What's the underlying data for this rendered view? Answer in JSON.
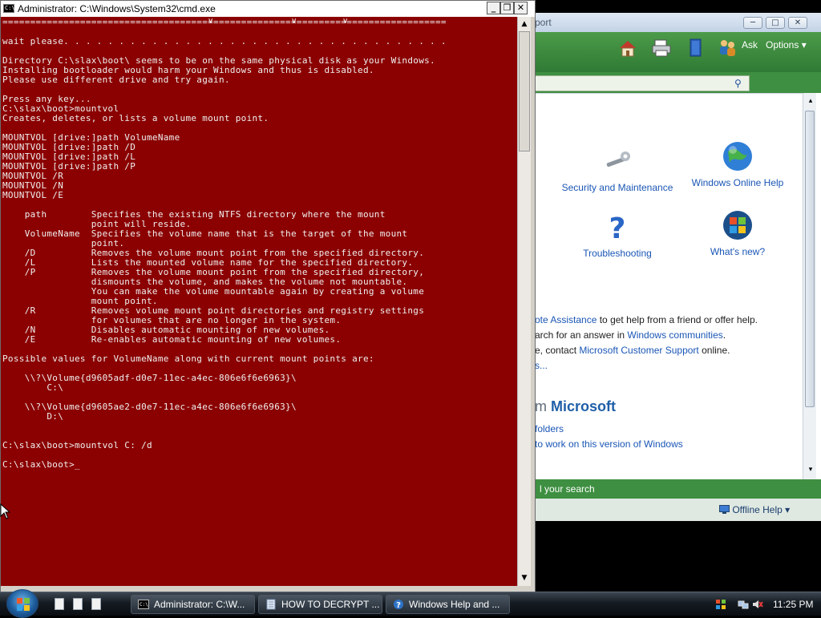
{
  "cmd": {
    "title": "Administrator: C:\\Windows\\System32\\cmd.exe",
    "icon_label": "C:\\",
    "lines": [
      "================================================================================",
      "",
      "wait please. . . . . . . . . . . . . . . . . . . . . . . . . . . . . . . . . . .",
      "",
      "Directory C:\\slax\\boot\\ seems to be on the same physical disk as your Windows.",
      "Installing bootloader would harm your Windows and thus is disabled.",
      "Please use different drive and try again.",
      "",
      "Press any key...",
      "C:\\slax\\boot>mountvol",
      "Creates, deletes, or lists a volume mount point.",
      "",
      "MOUNTVOL [drive:]path VolumeName",
      "MOUNTVOL [drive:]path /D",
      "MOUNTVOL [drive:]path /L",
      "MOUNTVOL [drive:]path /P",
      "MOUNTVOL /R",
      "MOUNTVOL /N",
      "MOUNTVOL /E",
      "",
      "    path        Specifies the existing NTFS directory where the mount",
      "                point will reside.",
      "    VolumeName  Specifies the volume name that is the target of the mount",
      "                point.",
      "    /D          Removes the volume mount point from the specified directory.",
      "    /L          Lists the mounted volume name for the specified directory.",
      "    /P          Removes the volume mount point from the specified directory,",
      "                dismounts the volume, and makes the volume not mountable.",
      "                You can make the volume mountable again by creating a volume",
      "                mount point.",
      "    /R          Removes volume mount point directories and registry settings",
      "                for volumes that are no longer in the system.",
      "    /N          Disables automatic mounting of new volumes.",
      "    /E          Re-enables automatic mounting of new volumes.",
      "",
      "Possible values for VolumeName along with current mount points are:",
      "",
      "    \\\\?\\Volume{d9605adf-d0e7-11ec-a4ec-806e6f6e6963}\\",
      "        C:\\",
      "",
      "    \\\\?\\Volume{d9605ae2-d0e7-11ec-a4ec-806e6f6e6963}\\",
      "        D:\\",
      "",
      "",
      "C:\\slax\\boot>mountvol C: /d",
      "",
      "C:\\slax\\boot>_"
    ],
    "colors": {
      "background": "#8b0000",
      "text": "#f0f0f0"
    }
  },
  "help": {
    "title": "port",
    "toolbar": {
      "ask": "Ask",
      "options": "Options"
    },
    "tiles": [
      {
        "label": "Security and Maintenance",
        "icon": "wrench-icon"
      },
      {
        "label": "Windows Online Help",
        "icon": "globe-icon"
      },
      {
        "label": "Troubleshooting",
        "icon": "question-icon"
      },
      {
        "label": "What's new?",
        "icon": "windows-logo-icon"
      }
    ],
    "lines": [
      {
        "link": "ote Assistance",
        "text": " to get help from a friend or offer help."
      },
      {
        "text": "arch for an answer in ",
        "link": "Windows communities",
        "tail": "."
      },
      {
        "text": "e, contact ",
        "link": "Microsoft Customer Support",
        "tail": " online."
      },
      {
        "link": "s..."
      }
    ],
    "ms_heading_prefix": "m",
    "ms_heading": "Microsoft",
    "ms_links": [
      "folders",
      "to work on this version of Windows"
    ],
    "footer_text": "l your search",
    "offline": "Offline Help",
    "accent": "#3e8f41"
  },
  "taskbar": {
    "buttons": [
      {
        "label": "Administrator: C:\\W...",
        "icon": "cmd-icon"
      },
      {
        "label": "HOW TO DECRYPT ...",
        "icon": "notepad-icon"
      },
      {
        "label": "Windows Help and ...",
        "icon": "help-icon"
      }
    ],
    "clock": "11:25 PM"
  }
}
